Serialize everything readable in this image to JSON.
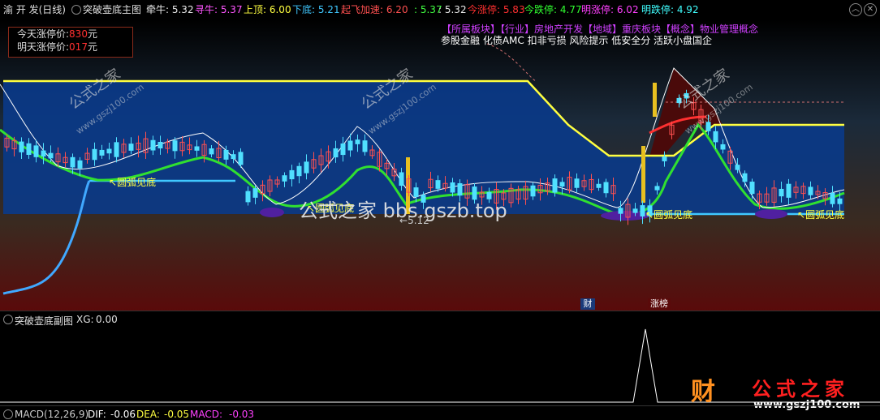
{
  "header": {
    "stock": "渝 开 发(日线)",
    "indicator": "突破壶底主图",
    "items": [
      {
        "label": "牵牛:",
        "value": "5.32",
        "color": "#e8e8e8"
      },
      {
        "label": "寻牛:",
        "value": "5.37",
        "color": "#ff55ff"
      },
      {
        "label": "上顶:",
        "value": "6.00",
        "color": "#ffff40"
      },
      {
        "label": "下底:",
        "value": "5.21",
        "color": "#40c8ff"
      },
      {
        "label": "起飞加速:",
        "value": "6.20",
        "color": "#ff5050"
      },
      {
        "label": ":",
        "value": "5.37",
        "color": "#40ff40"
      },
      {
        "label": ":",
        "value": "5.32",
        "color": "#e8e8e8"
      },
      {
        "label": "今涨停:",
        "value": "5.83",
        "color": "#ff3030"
      },
      {
        "label": "今跌停:",
        "value": "4.77",
        "color": "#30ff30"
      },
      {
        "label": "明涨停:",
        "value": "6.02",
        "color": "#ff40ff"
      },
      {
        "label": "明跌停:",
        "value": "4.92",
        "color": "#40ffff"
      }
    ]
  },
  "price_box": {
    "today_label": "今天涨停价:",
    "today_value": "830",
    "today_unit": "元",
    "tomorrow_label": "明天涨停价:",
    "tomorrow_value": "017",
    "tomorrow_unit": "元"
  },
  "sectors": {
    "line1": "【所属板块】【行业】房地产开发【地域】重庆板块【概念】物业管理概念",
    "line2": "参股金融 化债AMC 扣非亏损 风险提示 低安全分 活跃小盘国企"
  },
  "annotations": {
    "arc_bottom": "圆弧见底",
    "low_price": "5.12",
    "fin_tag": "财",
    "zb_tag": "涨榜"
  },
  "watermark": {
    "center": "公式之家 bbs.gszb.top",
    "small": "公式之家",
    "small_url": "www.gszj100.com",
    "logo_text": "公式之家",
    "logo_url": "www.gszj100.com",
    "logo_glyph": "财"
  },
  "sub_chart": {
    "title": "突破壶底副图",
    "label": "XG:",
    "value": "0.00"
  },
  "macd": {
    "title": "MACD(12,26,9)",
    "dif_label": "DIF:",
    "dif_value": "-0.06",
    "dea_label": "DEA:",
    "dea_value": "-0.05",
    "macd_label": "MACD:",
    "macd_value": "-0.03"
  }
}
